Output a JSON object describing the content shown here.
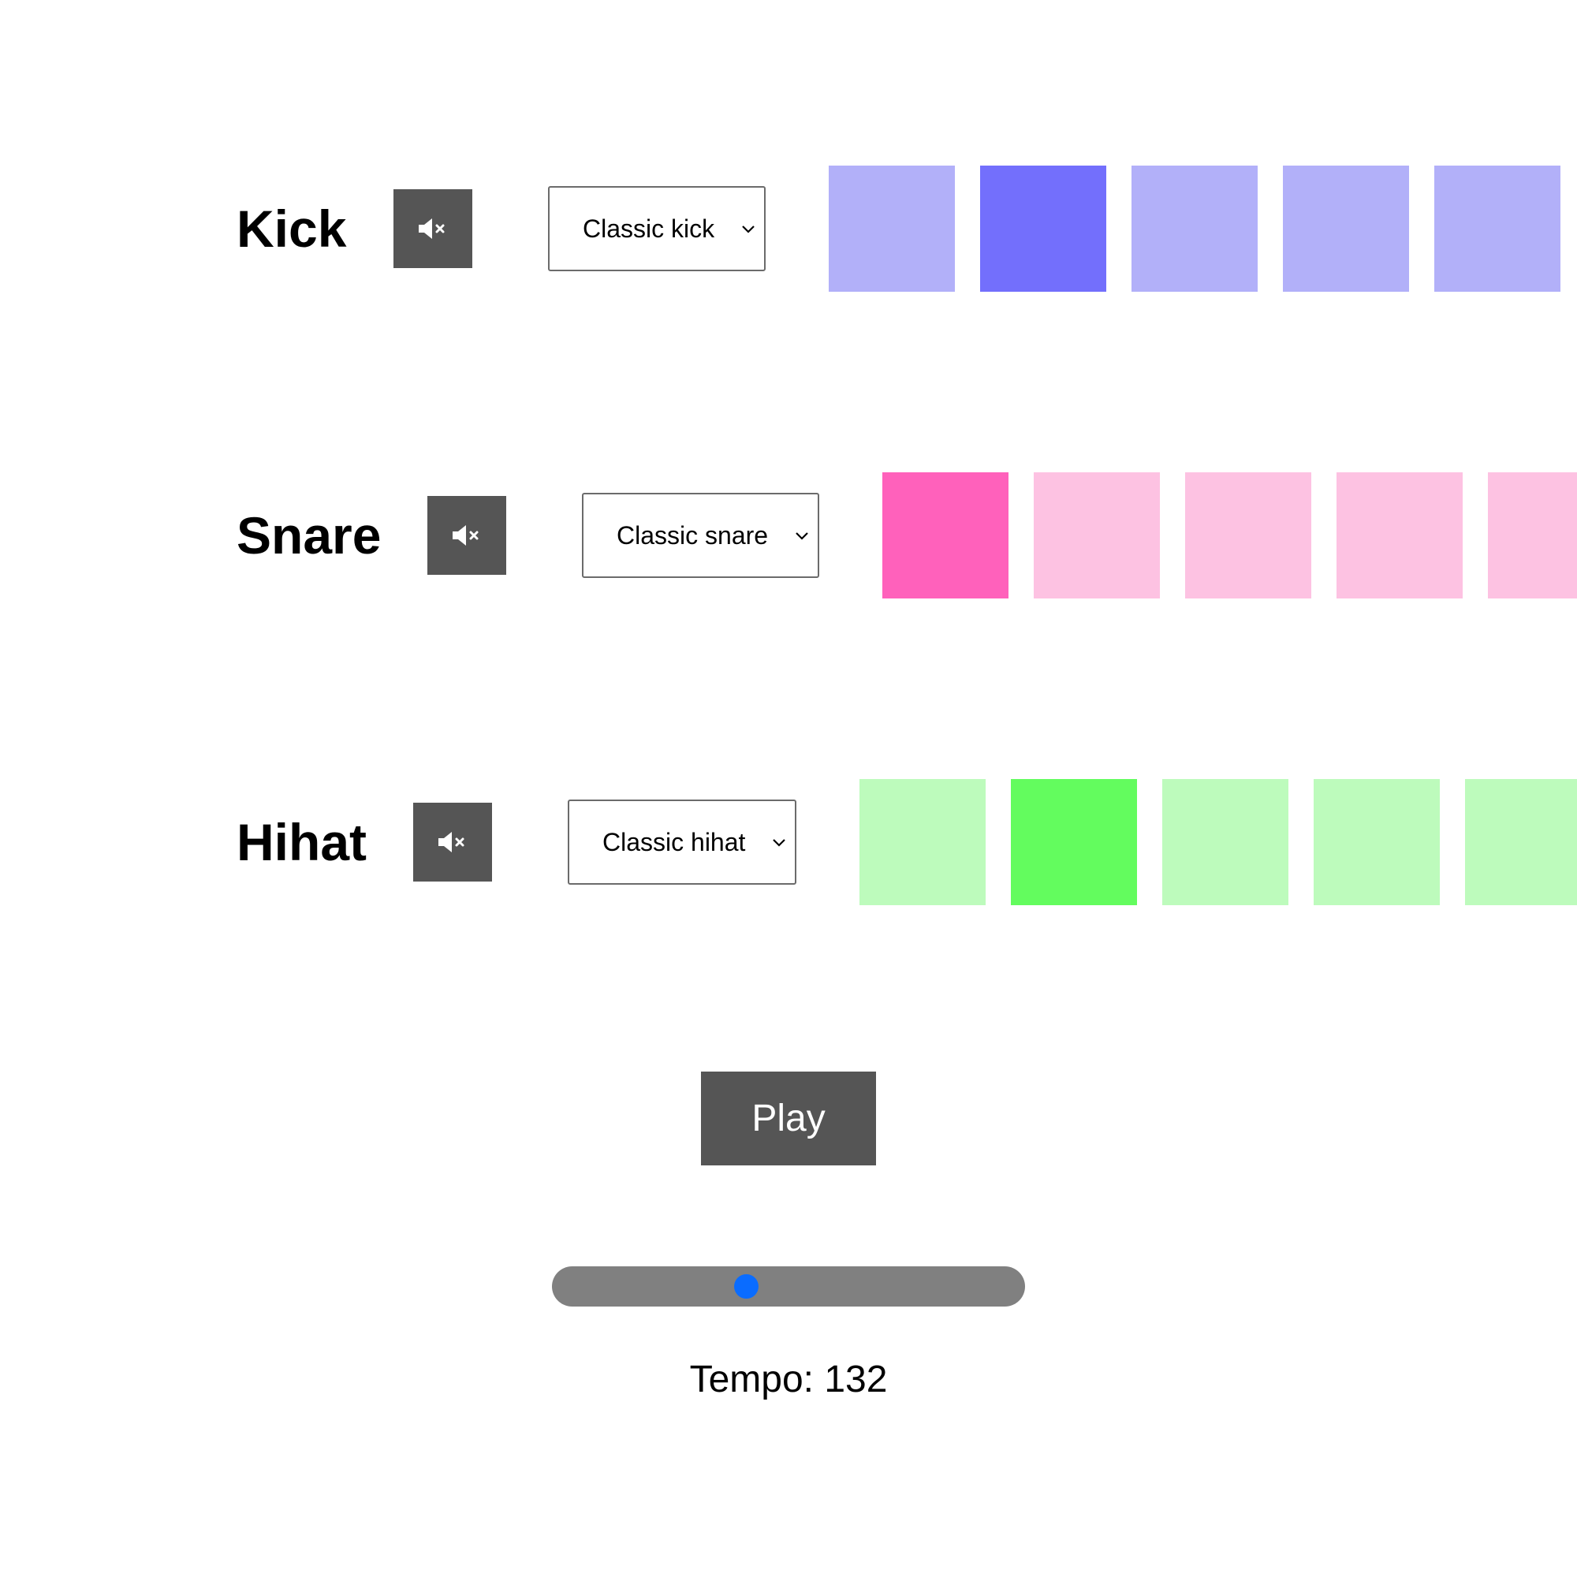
{
  "colors": {
    "button_bg": "#555555",
    "slider_track": "#808080",
    "slider_thumb": "#0a6cff"
  },
  "tracks": [
    {
      "label": "Kick",
      "mute_icon": "speaker-muted-icon",
      "sample": "Classic kick",
      "colors": {
        "off": "#b2b0f9",
        "on": "#736ffc"
      },
      "steps": [
        false,
        true,
        false,
        false,
        false
      ]
    },
    {
      "label": "Snare",
      "mute_icon": "speaker-muted-icon",
      "sample": "Classic snare",
      "colors": {
        "off": "#fdc2e2",
        "on": "#ff61bb"
      },
      "steps": [
        true,
        false,
        false,
        false,
        false
      ]
    },
    {
      "label": "Hihat",
      "mute_icon": "speaker-muted-icon",
      "sample": "Classic hihat",
      "colors": {
        "off": "#bdfbbc",
        "on": "#63fc5e"
      },
      "steps": [
        false,
        true,
        false,
        false,
        false
      ]
    }
  ],
  "transport": {
    "play_label": "Play"
  },
  "tempo": {
    "value": 132,
    "slider_fraction": 0.41,
    "readout": "Tempo: 132"
  }
}
